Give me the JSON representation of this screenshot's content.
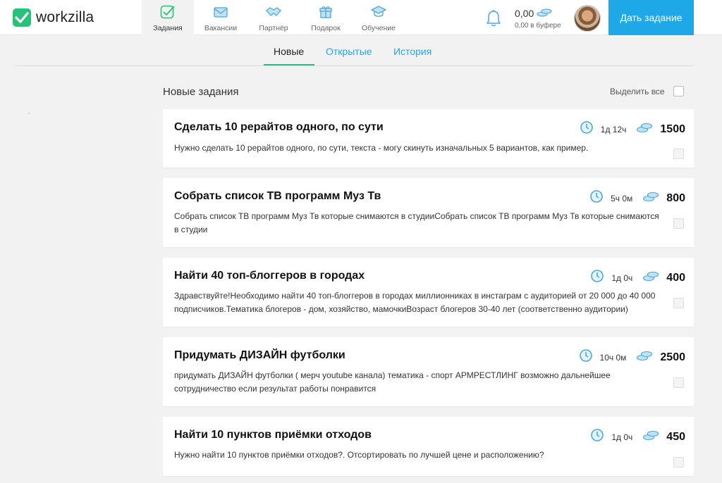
{
  "header": {
    "logo_text": "workzilla",
    "nav": [
      {
        "label": "Задания",
        "icon": "tasks-check-icon",
        "active": true
      },
      {
        "label": "Вакансии",
        "icon": "envelope-icon",
        "active": false
      },
      {
        "label": "Партнёр",
        "icon": "handshake-icon",
        "active": false
      },
      {
        "label": "Подарок",
        "icon": "gift-icon",
        "active": false
      },
      {
        "label": "Обучение",
        "icon": "graduation-cap-icon",
        "active": false
      }
    ],
    "balance_amount": "0,00",
    "balance_sub": "0,00 в буфере",
    "cta_label": "Дать задание"
  },
  "subtabs": [
    {
      "label": "Новые",
      "active": true
    },
    {
      "label": "Открытые",
      "active": false
    },
    {
      "label": "История",
      "active": false
    }
  ],
  "list": {
    "title": "Новые задания",
    "select_all_label": "Выделить все"
  },
  "tasks": [
    {
      "title": "Сделать 10 рерайтов одного, по сути",
      "description": "Нужно сделать 10 рерайтов одного, по сути, текста - могу скинуть изначальных 5 вариантов, как пример.",
      "time": "1д 12ч",
      "price": "1500"
    },
    {
      "title": "Собрать список ТВ программ Муз Тв",
      "description": "Собрать список ТВ программ Муз Тв которые снимаются в студииСобрать список ТВ программ Муз Тв которые снимаются в студии",
      "time": "5ч 0м",
      "price": "800"
    },
    {
      "title": "Найти 40 топ-блоггеров в городах",
      "description": "Здравствуйте!Необходимо найти 40 топ-блоггеров в городах миллионниках в инстаграм с аудиторией от 20 000 до 40 000 подписчиков.Тематика блогеров - дом, хозяйство, мамочкиВозраст блогеров 30-40 лет (соответственно аудитории)",
      "time": "1д 0ч",
      "price": "400"
    },
    {
      "title": "Придумать ДИЗАЙН футболки",
      "description": "придумать ДИЗАЙН футболки ( мерч youtube канала) тематика - спорт АРМРЕСТЛИНГ возможно дальнейшее сотрудничество если результат работы понравится",
      "time": "10ч 0м",
      "price": "2500"
    },
    {
      "title": "Найти 10 пунктов приёмки отходов",
      "description": "Нужно найти 10 пунктов приёмки отходов?. Отсортировать по лучшей цене и расположению?",
      "time": "1д 0ч",
      "price": "450"
    }
  ],
  "colors": {
    "brand_green": "#27c27a",
    "accent_blue": "#1ea8e8",
    "icon_blue": "#4aa8d8"
  }
}
